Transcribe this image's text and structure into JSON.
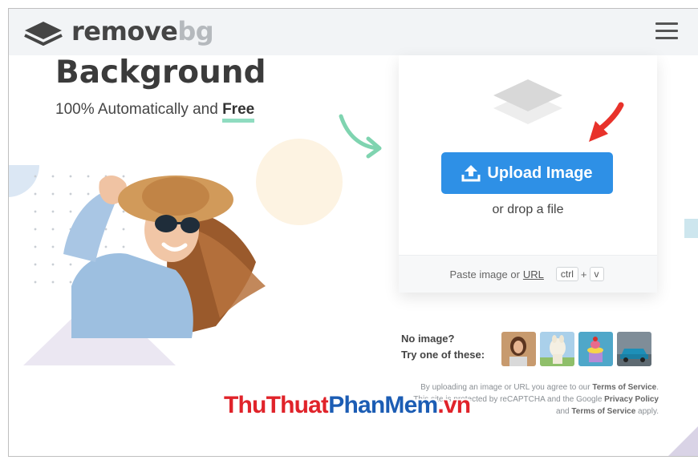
{
  "header": {
    "logo_text_main": "remove",
    "logo_text_accent": "bg",
    "menu_icon": "hamburger-menu-icon"
  },
  "hero": {
    "title": "Background",
    "subtitle_prefix": "100% Automatically and ",
    "subtitle_emphasis": "Free"
  },
  "upload": {
    "button_label": "Upload Image",
    "drop_text": "or drop a file",
    "paste_prefix": "Paste image or",
    "paste_url": "URL",
    "key_ctrl": "ctrl",
    "key_plus": "+",
    "key_v": "v"
  },
  "samples": {
    "label_line1": "No image?",
    "label_line2": "Try one of these:",
    "thumbnails": [
      "woman",
      "llama",
      "cake",
      "car"
    ]
  },
  "terms": {
    "line1_prefix": "By uploading an image or URL you agree to our ",
    "line1_link": "Terms of Service",
    "line1_suffix": ".",
    "line2_prefix": "This site is protected by reCAPTCHA and the Google ",
    "line2_link": "Privacy Policy",
    "line3_prefix": "and ",
    "line3_link": "Terms of Service",
    "line3_suffix": " apply."
  },
  "watermark": {
    "part1": "ThuThuat",
    "part2": "PhanMem",
    "part3": ".vn"
  },
  "colors": {
    "accent_blue": "#2e90e6",
    "free_underline": "#8fdcc0",
    "arrow_green": "#7fd4b0",
    "pointer_red": "#e8322b"
  }
}
